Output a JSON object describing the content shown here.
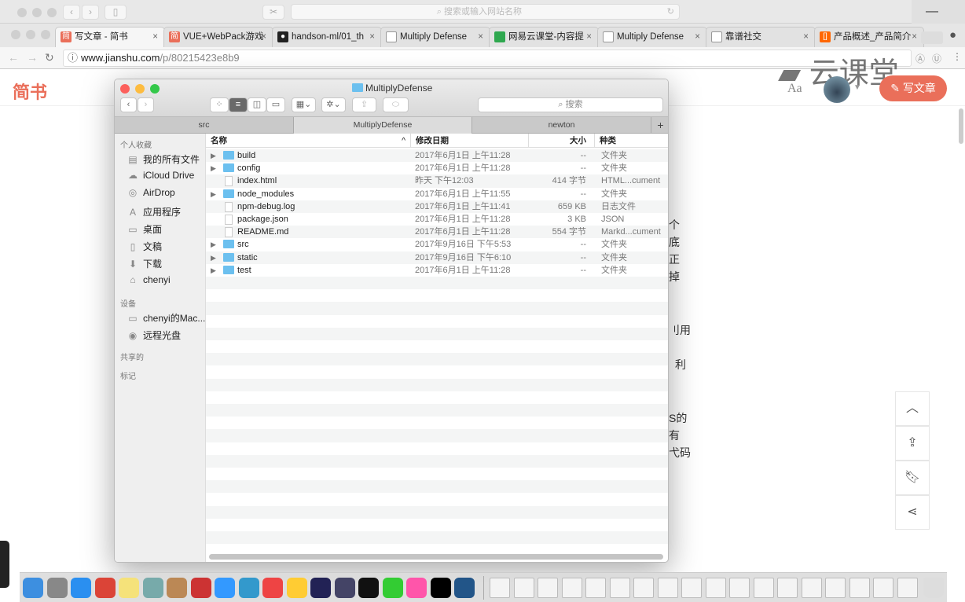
{
  "safari": {
    "search_placeholder": "搜索或输入网站名称",
    "min": "—"
  },
  "chrome": {
    "tabs": [
      {
        "label": "写文章 - 简书",
        "icon": "jianshu-icon",
        "fav": "简",
        "color": "#ea6f5a"
      },
      {
        "label": "VUE+WebPack游戏",
        "icon": "jianshu-icon",
        "fav": "简",
        "color": "#ea6f5a"
      },
      {
        "label": "handson-ml/01_th",
        "icon": "github-icon",
        "fav": "●",
        "color": "#222"
      },
      {
        "label": "Multiply Defense",
        "icon": "page-icon",
        "fav": "",
        "color": "#fff"
      },
      {
        "label": "网易云课堂-内容提",
        "icon": "netease-icon",
        "fav": "",
        "color": "#2fa84f"
      },
      {
        "label": "Multiply Defense",
        "icon": "page-icon",
        "fav": "",
        "color": "#fff"
      },
      {
        "label": "靠谱社交",
        "icon": "page-icon",
        "fav": "",
        "color": "#fff"
      },
      {
        "label": "产品概述_产品简介",
        "icon": "aliyun-icon",
        "fav": "[]",
        "color": "#f60"
      }
    ],
    "url_host": "www.jianshu.com",
    "url_path": "/p/80215423e8b9"
  },
  "page": {
    "logo": "简书",
    "write_label": "写文章",
    "aa": "Aa",
    "watermark": "云课堂",
    "fragments": [
      "个",
      "底",
      "正",
      "掉",
      "刂用",
      "利",
      "S的",
      "有",
      "弋码"
    ]
  },
  "finder": {
    "title": "MultiplyDefense",
    "search_placeholder": "搜索",
    "tabs": [
      "src",
      "MultiplyDefense",
      "newton"
    ],
    "sidebar": {
      "favorites_header": "个人收藏",
      "favorites": [
        {
          "label": "我的所有文件",
          "icon": "all-files-icon",
          "g": "▤"
        },
        {
          "label": "iCloud Drive",
          "icon": "cloud-icon",
          "g": "☁"
        },
        {
          "label": "AirDrop",
          "icon": "airdrop-icon",
          "g": "◎"
        },
        {
          "label": "应用程序",
          "icon": "applications-icon",
          "g": "A"
        },
        {
          "label": "桌面",
          "icon": "desktop-icon",
          "g": "▭"
        },
        {
          "label": "文稿",
          "icon": "documents-icon",
          "g": "▯"
        },
        {
          "label": "下载",
          "icon": "downloads-icon",
          "g": "⬇"
        },
        {
          "label": "chenyi",
          "icon": "home-icon",
          "g": "⌂"
        }
      ],
      "devices_header": "设备",
      "devices": [
        {
          "label": "chenyi的Mac...",
          "icon": "laptop-icon",
          "g": "▭"
        },
        {
          "label": "远程光盘",
          "icon": "disc-icon",
          "g": "◉"
        }
      ],
      "shared_header": "共享的",
      "tags_header": "标记"
    },
    "columns": {
      "name": "名称",
      "date": "修改日期",
      "size": "大小",
      "kind": "种类"
    },
    "files": [
      {
        "name": "build",
        "date": "2017年6月1日 上午11:28",
        "size": "--",
        "kind": "文件夹",
        "folder": true
      },
      {
        "name": "config",
        "date": "2017年6月1日 上午11:28",
        "size": "--",
        "kind": "文件夹",
        "folder": true
      },
      {
        "name": "index.html",
        "date": "昨天 下午12:03",
        "size": "414 字节",
        "kind": "HTML...cument",
        "folder": false
      },
      {
        "name": "node_modules",
        "date": "2017年6月1日 上午11:55",
        "size": "--",
        "kind": "文件夹",
        "folder": true
      },
      {
        "name": "npm-debug.log",
        "date": "2017年6月1日 上午11:41",
        "size": "659 KB",
        "kind": "日志文件",
        "folder": false
      },
      {
        "name": "package.json",
        "date": "2017年6月1日 上午11:28",
        "size": "3 KB",
        "kind": "JSON",
        "folder": false
      },
      {
        "name": "README.md",
        "date": "2017年6月1日 上午11:28",
        "size": "554 字节",
        "kind": "Markd...cument",
        "folder": false
      },
      {
        "name": "src",
        "date": "2017年9月16日 下午5:53",
        "size": "--",
        "kind": "文件夹",
        "folder": true
      },
      {
        "name": "static",
        "date": "2017年9月16日 下午6:10",
        "size": "--",
        "kind": "文件夹",
        "folder": true
      },
      {
        "name": "test",
        "date": "2017年6月1日 上午11:28",
        "size": "--",
        "kind": "文件夹",
        "folder": true
      }
    ]
  },
  "dock": {
    "colors": [
      "#3d8fe0",
      "#888",
      "#2a8ff0",
      "#db4437",
      "#f5e27a",
      "#7aa",
      "#b85",
      "#c33",
      "#39f",
      "#39c",
      "#e44",
      "#fc3",
      "#225",
      "#446",
      "#111",
      "#3c3",
      "#f5a",
      "#000",
      "#258"
    ]
  }
}
